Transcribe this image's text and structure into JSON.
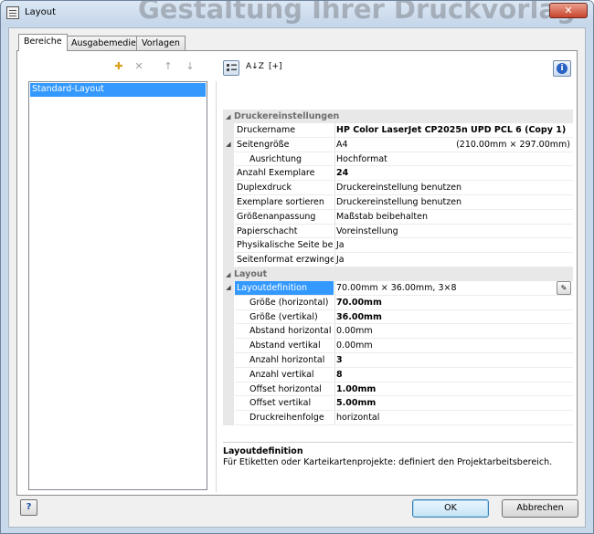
{
  "window": {
    "title": "Layout",
    "watermark": "Gestaltung Ihrer Druckvorlag",
    "close": "✕"
  },
  "tabs": [
    "Bereiche",
    "Ausgabemedien",
    "Vorlagen"
  ],
  "left_toolbar": {
    "add": "add-icon",
    "delete": "delete-icon",
    "up": "arrow-up-icon",
    "down": "arrow-down-icon"
  },
  "list": {
    "items": [
      "Standard-Layout"
    ]
  },
  "right_toolbar": {
    "az": "A↓Z",
    "expand": "[+]"
  },
  "property_grid": {
    "categories": [
      {
        "title": "Druckereinstellungen",
        "rows": [
          {
            "name": "Druckername",
            "value": "HP Color LaserJet CP2025n UPD PCL 6 (Copy 1)",
            "bold": true
          },
          {
            "name": "Seitengröße",
            "value": "A4",
            "extra": "(210.00mm × 297.00mm)",
            "expander": true
          },
          {
            "name": "Ausrichtung",
            "value": "Hochformat",
            "indent": true
          },
          {
            "name": "Anzahl Exemplare",
            "value": "24",
            "bold": true
          },
          {
            "name": "Duplexdruck",
            "value": "Druckereinstellung benutzen"
          },
          {
            "name": "Exemplare sortieren",
            "value": "Druckereinstellung benutzen"
          },
          {
            "name": "Größenanpassung",
            "value": "Maßstab beibehalten"
          },
          {
            "name": "Papierschacht",
            "value": "Voreinstellung"
          },
          {
            "name": "Physikalische Seite be...",
            "value": "Ja"
          },
          {
            "name": "Seitenformat erzwingen",
            "value": "Ja"
          }
        ]
      },
      {
        "title": "Layout",
        "rows": [
          {
            "name": "Layoutdefinition",
            "value": "70.00mm × 36.00mm, 3×8",
            "expander": true,
            "selected": true,
            "editor": true
          },
          {
            "name": "Größe (horizontal)",
            "value": "70.00mm",
            "bold": true,
            "indent": true
          },
          {
            "name": "Größe (vertikal)",
            "value": "36.00mm",
            "bold": true,
            "indent": true
          },
          {
            "name": "Abstand horizontal",
            "value": "0.00mm",
            "indent": true
          },
          {
            "name": "Abstand vertikal",
            "value": "0.00mm",
            "indent": true
          },
          {
            "name": "Anzahl horizontal",
            "value": "3",
            "bold": true,
            "indent": true
          },
          {
            "name": "Anzahl vertikal",
            "value": "8",
            "bold": true,
            "indent": true
          },
          {
            "name": "Offset horizontal",
            "value": "1.00mm",
            "bold": true,
            "indent": true
          },
          {
            "name": "Offset vertikal",
            "value": "5.00mm",
            "bold": true,
            "indent": true
          },
          {
            "name": "Druckreihenfolge",
            "value": "horizontal",
            "indent": true
          }
        ]
      }
    ]
  },
  "description": {
    "title": "Layoutdefinition",
    "text": "Für Etiketten oder Karteikartenprojekte: definiert den Projektarbeitsbereich."
  },
  "buttons": {
    "help": "?",
    "ok": "OK",
    "cancel": "Abbrechen"
  },
  "colors": {
    "selection": "#3399ff",
    "window_frame": "#c9d9ec"
  }
}
